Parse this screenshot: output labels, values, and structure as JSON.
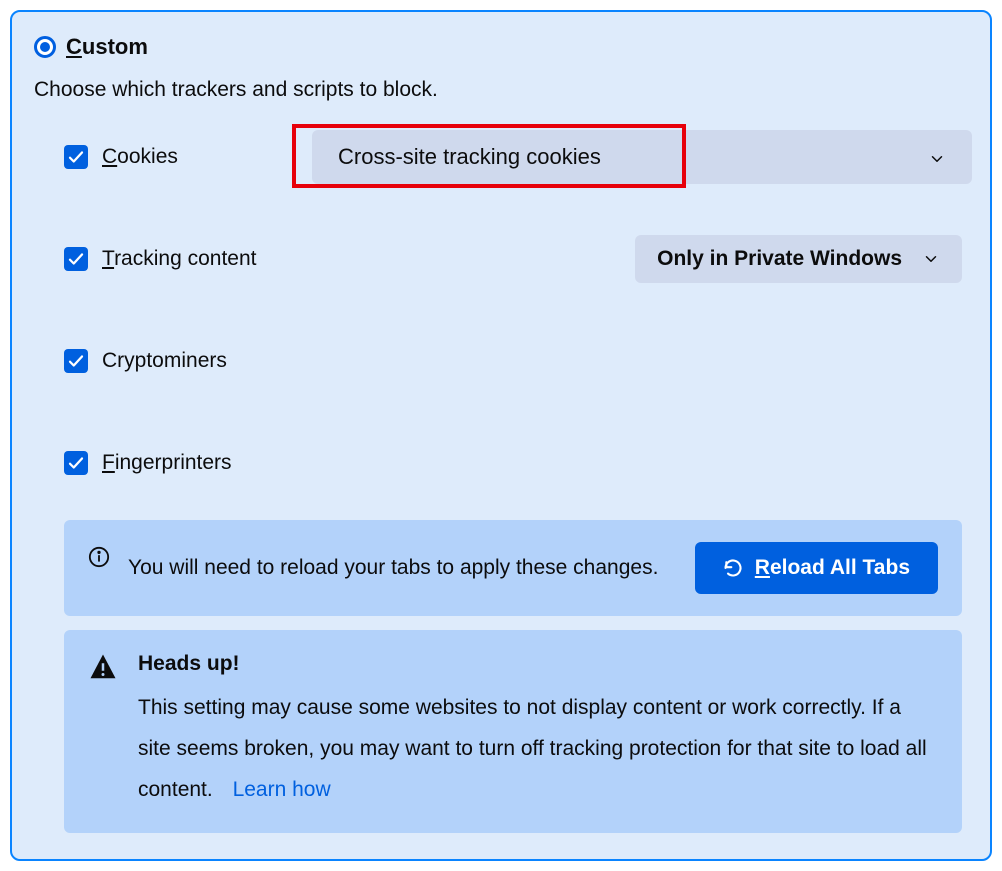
{
  "radio": {
    "label": "Custom"
  },
  "description": "Choose which trackers and scripts to block.",
  "options": {
    "cookies": {
      "label": "Cookies",
      "dropdown": "Cross-site tracking cookies"
    },
    "tracking": {
      "label": "Tracking content",
      "dropdown": "Only in Private Windows"
    },
    "cryptominers": {
      "label": "Cryptominers"
    },
    "fingerprinters": {
      "label": "Fingerprinters"
    }
  },
  "notice": {
    "text": "You will need to reload your tabs to apply these changes.",
    "button": "Reload All Tabs"
  },
  "warning": {
    "title": "Heads up!",
    "body": "This setting may cause some websites to not display content or work correctly. If a site seems broken, you may want to turn off tracking protection for that site to load all content.",
    "link": "Learn how"
  }
}
